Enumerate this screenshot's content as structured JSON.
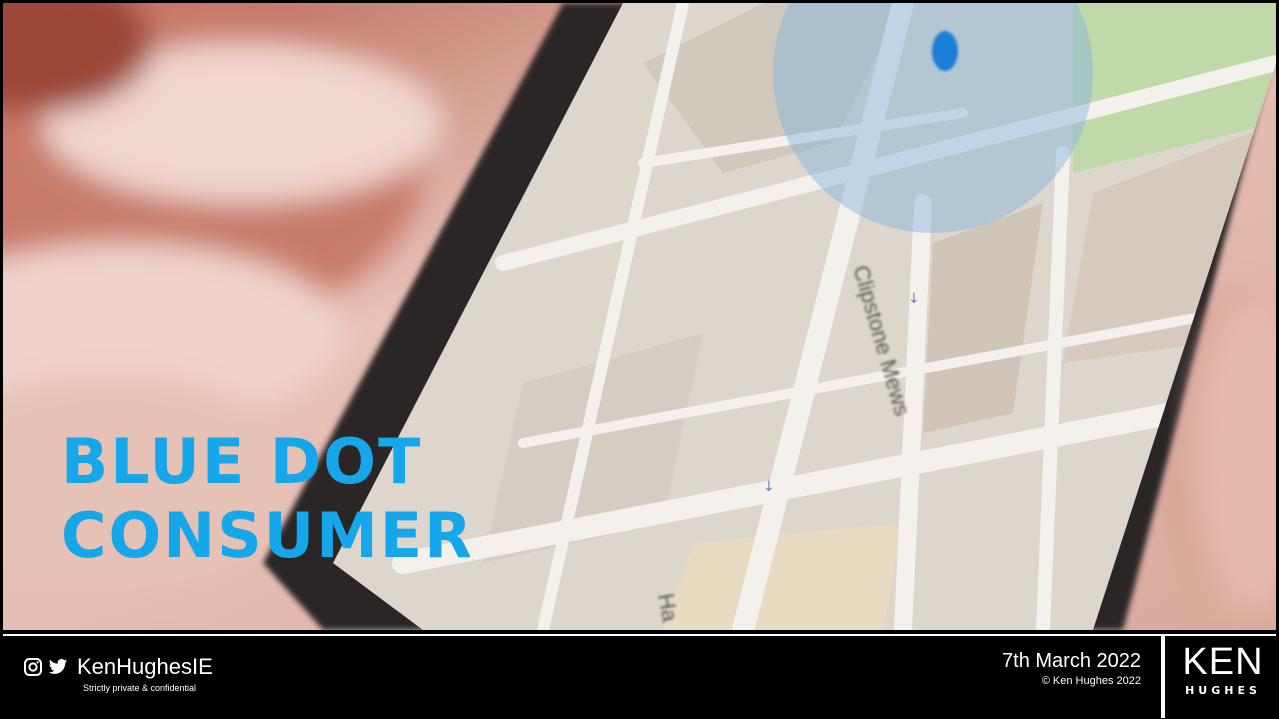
{
  "slide": {
    "title_line1": "BLUE DOT",
    "title_line2": "CONSUMER",
    "title_color": "#16a6ea"
  },
  "map_labels": {
    "street1": "Clipstone Mews",
    "street2": "Ha"
  },
  "footer": {
    "social_icons": [
      "instagram-icon",
      "twitter-icon"
    ],
    "handle": "KenHughesIE",
    "confidential": "Strictly private & confidential",
    "date": "7th March 2022",
    "copyright": "© Ken Hughes 2022",
    "logo_top": "KEN",
    "logo_bottom": "HUGHES"
  }
}
